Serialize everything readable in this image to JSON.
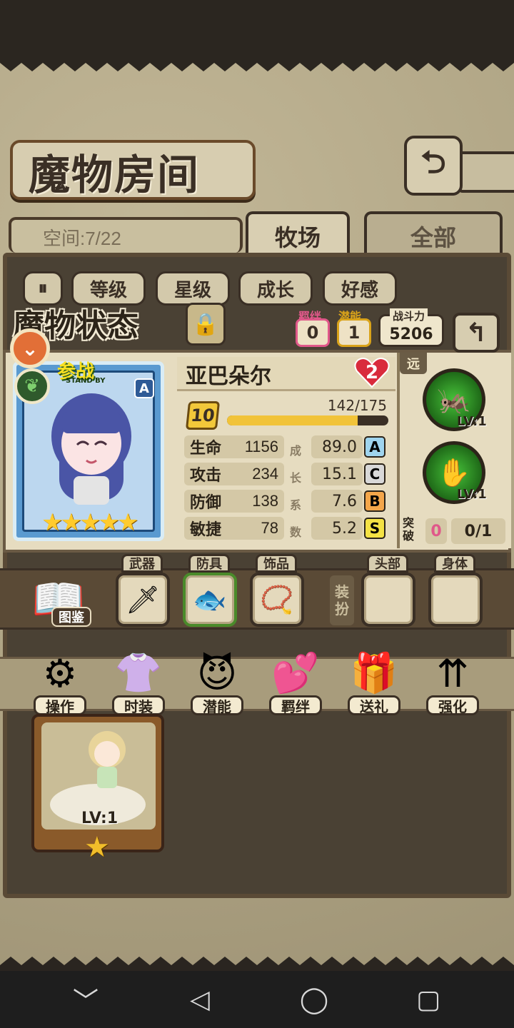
{
  "header": {
    "title": "魔物房间",
    "back_icon": "back-arrow-icon"
  },
  "space": {
    "text": "空间:7/22"
  },
  "tabs": [
    {
      "label": "牧场",
      "active": true
    },
    {
      "label": "全部",
      "active": false
    }
  ],
  "filters": {
    "sort_icon": "sort-toggle-icon",
    "items": [
      "等级",
      "星级",
      "成长",
      "好感"
    ]
  },
  "status": {
    "title": "魔物状态",
    "bond_label": "羁绊",
    "bond_value": "0",
    "potential_label": "潜能",
    "potential_value": "1",
    "power_label": "战斗力",
    "power_value": "5206"
  },
  "monster": {
    "name": "亚巴朵尔",
    "heart_value": "2",
    "standby_text": "参战",
    "standby_sub": "STAND BY",
    "rank": "A",
    "star_count": 5,
    "stars": "★★★★★",
    "level": "10",
    "exp_text": "142/175",
    "exp_ratio": 0.811,
    "stats": [
      {
        "label": "生命",
        "value": "1156",
        "growth": "89.0",
        "grade": "A"
      },
      {
        "label": "攻击",
        "value": "234",
        "growth": "15.1",
        "grade": "C"
      },
      {
        "label": "防御",
        "value": "138",
        "growth": "7.6",
        "grade": "B"
      },
      {
        "label": "敏捷",
        "value": "78",
        "growth": "5.2",
        "grade": "S"
      }
    ],
    "growth_vertical": [
      "成",
      "长",
      "系",
      "数"
    ]
  },
  "skills": {
    "range": "远",
    "items": [
      {
        "lv": "LV:1"
      },
      {
        "lv": "LV:1"
      }
    ],
    "break_label": "突破",
    "break_value": "0",
    "break_progress": "0/1"
  },
  "equipment": {
    "book_label": "图鉴",
    "slots": [
      {
        "label": "武器"
      },
      {
        "label": "防具"
      },
      {
        "label": "饰品"
      }
    ],
    "dress_label": [
      "装",
      "扮"
    ],
    "dress_slots": [
      {
        "label": "头部"
      },
      {
        "label": "身体"
      }
    ]
  },
  "actions": [
    {
      "label": "操作"
    },
    {
      "label": "时装"
    },
    {
      "label": "潜能"
    },
    {
      "label": "羁绊"
    },
    {
      "label": "送礼"
    },
    {
      "label": "强化"
    }
  ],
  "list_card": {
    "lv": "LV:1",
    "star": "★"
  },
  "nav": {
    "back": "﹀",
    "home": "◁",
    "circle": "◯",
    "square": "▢"
  },
  "colors": {
    "accent_gold": "#f1c339",
    "skill_green": "#47c33a",
    "heart_red": "#d92b3c",
    "grade_a": "#9fd4ee",
    "grade_c": "#d8d8d8",
    "grade_b": "#f4a64a",
    "grade_s": "#f4e244"
  }
}
